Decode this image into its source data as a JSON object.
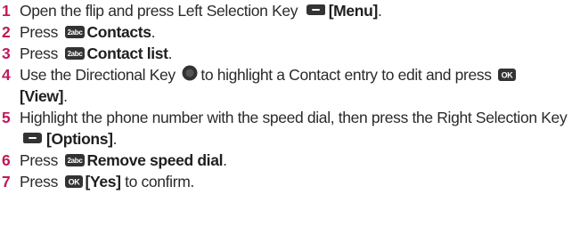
{
  "steps": [
    {
      "num": "1",
      "text_before": "Open the flip and press Left Selection Key",
      "icon": "left-selection-key-icon",
      "bold": "[Menu]",
      "text_after": "."
    },
    {
      "num": "2",
      "text_before": "Press",
      "icon": "key-2abc-icon",
      "key_text": "2abc",
      "bold": "Contacts",
      "text_after": "."
    },
    {
      "num": "3",
      "text_before": "Press",
      "icon": "key-2abc-icon",
      "key_text": "2abc",
      "bold": "Contact list",
      "text_after": "."
    },
    {
      "num": "4",
      "text_before": "Use the Directional Key",
      "icon": "directional-key-icon",
      "text_middle": "to highlight a Contact entry to edit and press",
      "icon2": "ok-key-icon",
      "key_text2": "OK",
      "bold": "[View]",
      "text_after": "."
    },
    {
      "num": "5",
      "text_before": "Highlight the phone number with the speed dial, then press the Right Selection Key",
      "icon": "right-selection-key-icon",
      "bold": "[Options]",
      "text_after": "."
    },
    {
      "num": "6",
      "text_before": "Press",
      "icon": "key-2abc-icon",
      "key_text": "2abc",
      "bold": "Remove speed dial",
      "text_after": "."
    },
    {
      "num": "7",
      "text_before": "Press",
      "icon": "ok-key-icon",
      "key_text": "OK",
      "bold": "[Yes]",
      "text_after": "to confirm."
    }
  ],
  "colors": {
    "step_number": "#c2185b",
    "text": "#2a2a2a",
    "key_fill": "#333333"
  }
}
